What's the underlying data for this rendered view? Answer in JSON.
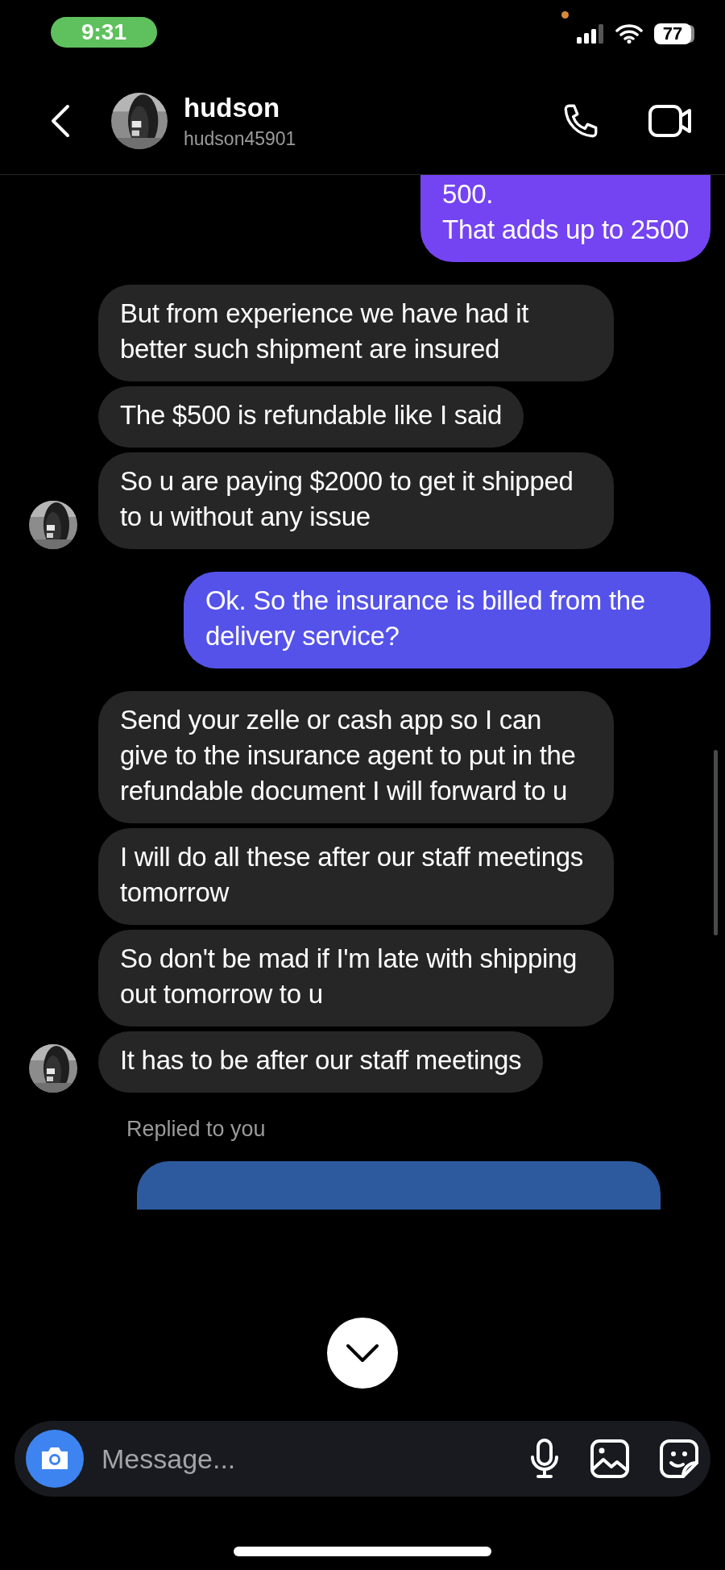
{
  "status_bar": {
    "time": "9:31",
    "battery": "77"
  },
  "header": {
    "name": "hudson",
    "username": "hudson45901"
  },
  "messages": [
    {
      "kind": "sent",
      "text": "500.\nThat adds up to 2500",
      "cut": true
    },
    {
      "kind": "received",
      "text": "But from experience we have had it better such shipment are insured",
      "cut": false
    },
    {
      "kind": "received",
      "text": "The $500 is refundable like I said",
      "cut": false
    },
    {
      "kind": "received",
      "text": "So u are paying $2000 to get it shipped to u without any issue",
      "cut": false
    },
    {
      "kind": "sent",
      "text": "Ok. So the insurance is billed from the delivery service?",
      "cut": false
    },
    {
      "kind": "received",
      "text": "Send your zelle or cash app so I can give to the insurance agent to put in the refundable document I will forward to u",
      "cut": false
    },
    {
      "kind": "received",
      "text": "I will do all these after our staff meetings tomorrow",
      "cut": false
    },
    {
      "kind": "received",
      "text": "So don't be mad if I'm late with shipping out tomorrow to u",
      "cut": false
    },
    {
      "kind": "received",
      "text": "It has to be after our staff meetings",
      "cut": false
    }
  ],
  "reply_label": "Replied to you",
  "composer": {
    "placeholder": "Message..."
  }
}
